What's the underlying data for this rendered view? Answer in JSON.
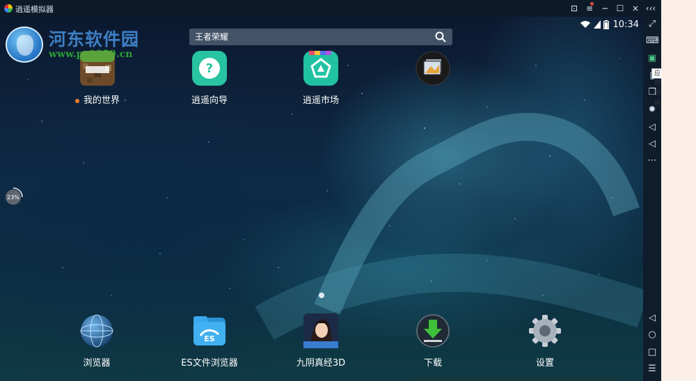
{
  "window": {
    "title": "逍遥模拟器"
  },
  "watermark": {
    "title": "河东软件园",
    "url": "www.pc0359.cn"
  },
  "status_bar": {
    "time": "10:34"
  },
  "search": {
    "text": "王者荣耀"
  },
  "apps_top": [
    {
      "label": "我的世界",
      "icon": "minecraft-icon",
      "new": true
    },
    {
      "label": "逍遥向导",
      "icon": "guide-icon",
      "new": false
    },
    {
      "label": "逍遥市场",
      "icon": "market-icon",
      "new": false
    },
    {
      "label": "",
      "icon": "gallery-icon",
      "new": false
    }
  ],
  "dock": [
    {
      "label": "浏览器",
      "icon": "browser-icon"
    },
    {
      "label": "ES文件浏览器",
      "icon": "es-file-explorer-icon"
    },
    {
      "label": "九阴真经3D",
      "icon": "game-icon"
    },
    {
      "label": "下载",
      "icon": "download-icon"
    },
    {
      "label": "设置",
      "icon": "settings-icon"
    }
  ],
  "progress": {
    "label": "23%",
    "value": 0.23
  },
  "sidebar": {
    "tooltip": "应用安装"
  },
  "colors": {
    "accent": "#4cc88a",
    "new_dot": "#f0822c",
    "title_bar": "#0d1a28"
  }
}
